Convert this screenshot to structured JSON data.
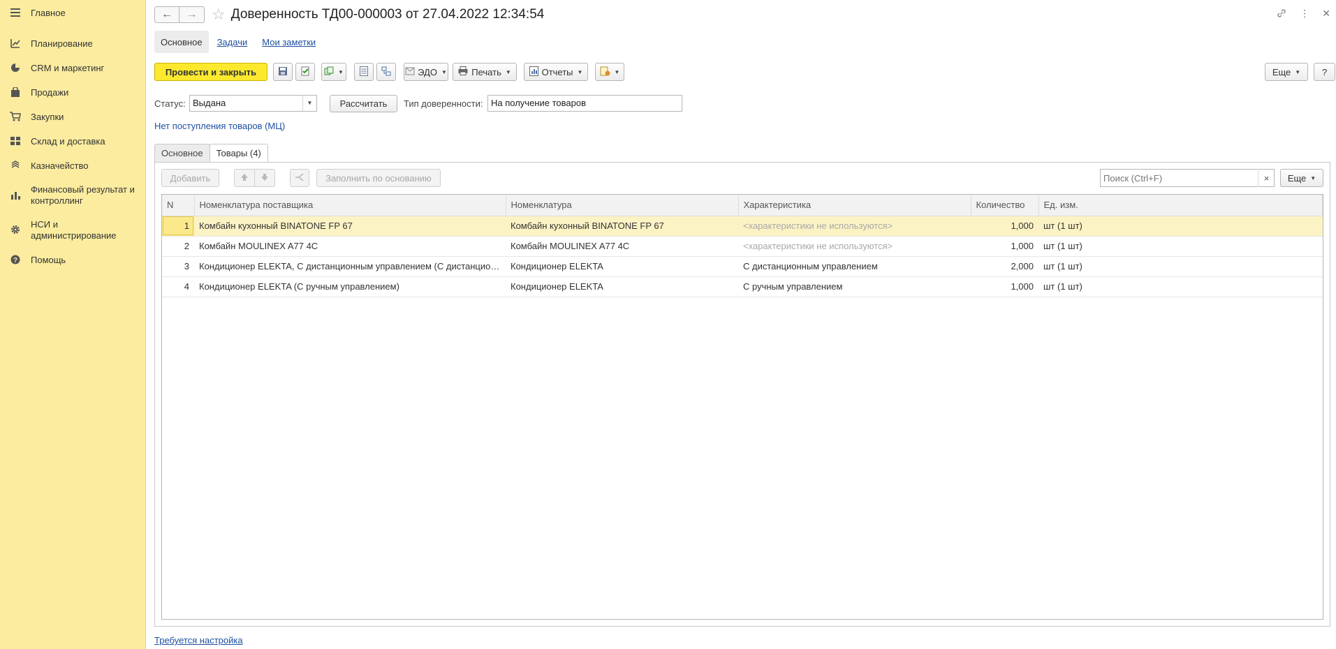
{
  "sidebar": {
    "items": [
      {
        "label": "Главное",
        "icon": "menu-icon"
      },
      {
        "label": "Планирование",
        "icon": "planning-icon"
      },
      {
        "label": "CRM и маркетинг",
        "icon": "pie-chart-icon"
      },
      {
        "label": "Продажи",
        "icon": "shopping-bag-icon"
      },
      {
        "label": "Закупки",
        "icon": "cart-icon"
      },
      {
        "label": "Склад и доставка",
        "icon": "warehouse-icon"
      },
      {
        "label": "Казначейство",
        "icon": "treasury-icon"
      },
      {
        "label": "Финансовый результат и контроллинг",
        "icon": "bar-chart-icon"
      },
      {
        "label": "НСИ и администрирование",
        "icon": "gear-icon"
      },
      {
        "label": "Помощь",
        "icon": "help-icon"
      }
    ]
  },
  "header": {
    "title": "Доверенность ТД00-000003 от 27.04.2022 12:34:54"
  },
  "subtabs": {
    "main": "Основное",
    "tasks": "Задачи",
    "notes": "Мои заметки"
  },
  "toolbar": {
    "post_close": "Провести и закрыть",
    "edo": "ЭДО",
    "print": "Печать",
    "reports": "Отчеты",
    "more": "Еще",
    "help": "?"
  },
  "form": {
    "status_label": "Статус:",
    "status_value": "Выдана",
    "calc_button": "Рассчитать",
    "type_label": "Тип доверенности:",
    "type_value": "На получение товаров",
    "info_link": "Нет поступления товаров (МЦ)"
  },
  "tabs": {
    "main": "Основное",
    "goods": "Товары (4)"
  },
  "goods": {
    "add": "Добавить",
    "fill": "Заполнить по основанию",
    "search_placeholder": "Поиск (Ctrl+F)",
    "search_clear": "×",
    "more": "Еще",
    "columns": [
      "N",
      "Номенклатура поставщика",
      "Номенклатура",
      "Характеристика",
      "Количество",
      "Ед. изм."
    ],
    "rows": [
      {
        "n": "1",
        "supplier": "Комбайн кухонный BINATONE FP 67",
        "item": "Комбайн кухонный BINATONE FP 67",
        "char": "<характеристики не используются>",
        "char_muted": true,
        "qty": "1,000",
        "unit": "шт (1 шт)"
      },
      {
        "n": "2",
        "supplier": "Комбайн MOULINEX  A77 4C",
        "item": "Комбайн MOULINEX  A77 4C",
        "char": "<характеристики не используются>",
        "char_muted": true,
        "qty": "1,000",
        "unit": "шт (1 шт)"
      },
      {
        "n": "3",
        "supplier": "Кондиционер ELEKTA, С дистанционным управлением (С дистанционным управлением)",
        "item": "Кондиционер ELEKTA",
        "char": "С дистанционным управлением",
        "char_muted": false,
        "qty": "2,000",
        "unit": "шт (1 шт)"
      },
      {
        "n": "4",
        "supplier": "Кондиционер ELEKTA (С ручным управлением)",
        "item": "Кондиционер ELEKTA",
        "char": "С ручным управлением",
        "char_muted": false,
        "qty": "1,000",
        "unit": "шт (1 шт)"
      }
    ]
  },
  "footer": {
    "setup_link": "Требуется настройка"
  }
}
